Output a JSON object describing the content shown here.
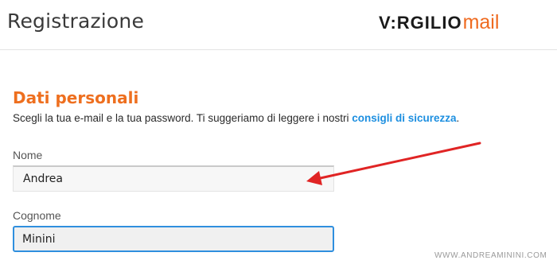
{
  "header": {
    "title": "Registrazione",
    "logo": {
      "brand": "V:RGILIO",
      "product": "mail"
    }
  },
  "section": {
    "title": "Dati personali",
    "intro_text": "Scegli la tua e-mail e la tua password. Ti suggeriamo di leggere i nostri ",
    "intro_link": "consigli di sicurezza",
    "intro_end": "."
  },
  "form": {
    "nome": {
      "label": "Nome",
      "value": "Andrea"
    },
    "cognome": {
      "label": "Cognome",
      "value": "Minini"
    }
  },
  "annotation": {
    "arrow_color": "#e02424"
  },
  "watermark": "WWW.ANDREAMININI.COM",
  "colors": {
    "accent": "#ee6f1f",
    "link": "#1d8fe0",
    "focus_border": "#2f8fde"
  }
}
